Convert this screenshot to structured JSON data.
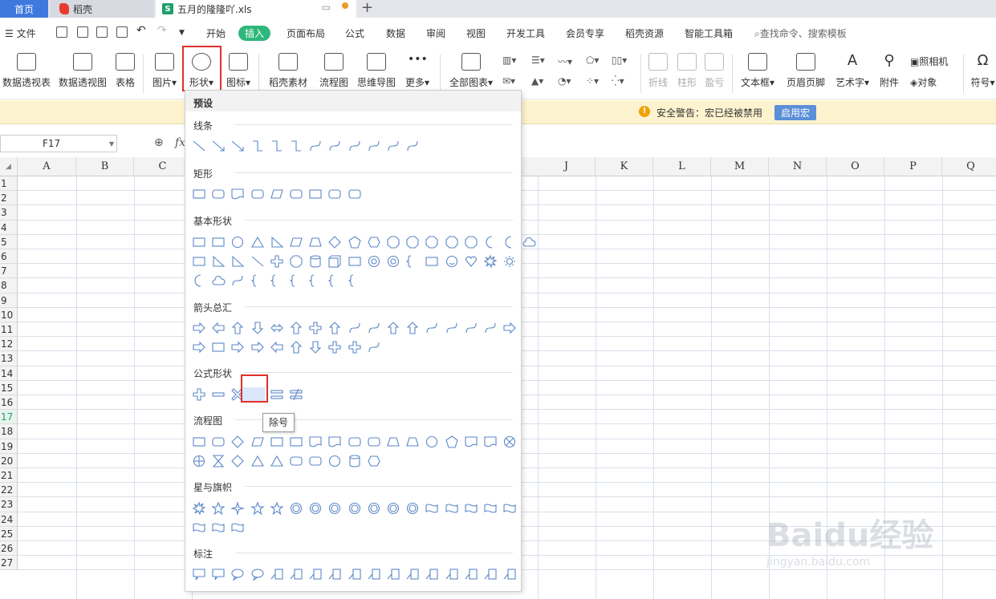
{
  "tabs": {
    "home": "首页",
    "wps": "稻壳",
    "file": "五月的隆隆吖.xls",
    "add": "+"
  },
  "menu": {
    "file": "文件",
    "items": [
      "开始",
      "插入",
      "页面布局",
      "公式",
      "数据",
      "审阅",
      "视图",
      "开发工具",
      "会员专享",
      "稻壳资源",
      "智能工具箱"
    ],
    "search": "查找命令、搜索模板"
  },
  "ribbon": {
    "buttons": [
      "数据透视表",
      "数据透视图",
      "表格",
      "图片",
      "形状",
      "图标",
      "稻壳素材",
      "流程图",
      "思维导图",
      "更多",
      "全部图表",
      "折线",
      "柱形",
      "盈亏",
      "文本框",
      "页眉页脚",
      "艺术字",
      "附件",
      "符号"
    ],
    "camera": "照相机",
    "object": "对象"
  },
  "warning": {
    "text": "安全警告：宏已经被禁用",
    "button": "启用宏"
  },
  "formula": {
    "cell": "F17",
    "fx": "fx"
  },
  "grid": {
    "columns": [
      "A",
      "B",
      "C",
      "J",
      "K",
      "L",
      "M",
      "N",
      "O",
      "P",
      "Q"
    ],
    "rows": [
      "1",
      "2",
      "3",
      "4",
      "5",
      "6",
      "7",
      "8",
      "9",
      "10",
      "11",
      "12",
      "13",
      "14",
      "15",
      "16",
      "17",
      "18",
      "19",
      "20",
      "21",
      "22",
      "23",
      "24",
      "25",
      "26",
      "27"
    ],
    "active_row": "17"
  },
  "dropdown": {
    "preset": "预设",
    "sections": [
      "线条",
      "矩形",
      "基本形状",
      "箭头总汇",
      "公式形状",
      "流程图",
      "星与旗帜",
      "标注"
    ],
    "tooltip": "除号"
  },
  "watermark": {
    "main": "Baidu经验",
    "sub": "jingyan.baidu.com"
  },
  "colors": {
    "accent": "#2eb77a",
    "tab_blue": "#3f79dd",
    "highlight": "#e0302a",
    "shape_blue": "#5b87c7"
  }
}
